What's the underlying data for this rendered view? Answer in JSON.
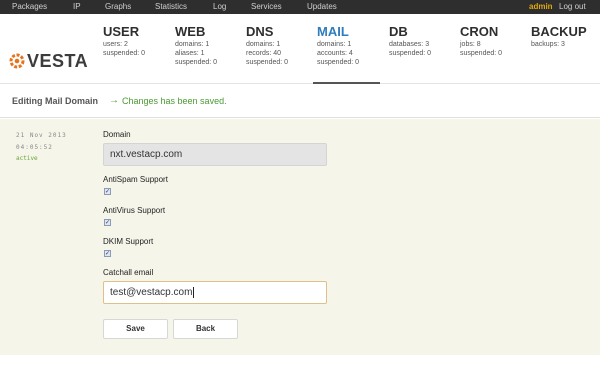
{
  "topnav": {
    "packages": "Packages",
    "ip": "IP",
    "graphs": "Graphs",
    "statistics": "Statistics",
    "log": "Log",
    "services": "Services",
    "updates": "Updates",
    "user": "admin",
    "logout": "Log out"
  },
  "logo": {
    "text": "VESTA",
    "icon": "vesta-gear-logo-icon"
  },
  "sections": {
    "user": {
      "title": "USER",
      "stats": [
        "users: 2",
        "suspended: 0"
      ]
    },
    "web": {
      "title": "WEB",
      "stats": [
        "domains: 1",
        "aliases: 1",
        "suspended: 0"
      ]
    },
    "dns": {
      "title": "DNS",
      "stats": [
        "domains: 1",
        "records: 40",
        "suspended: 0"
      ]
    },
    "mail": {
      "title": "MAIL",
      "stats": [
        "domains: 1",
        "accounts: 4",
        "suspended: 0"
      ]
    },
    "db": {
      "title": "DB",
      "stats": [
        "databases: 3",
        "suspended: 0"
      ]
    },
    "cron": {
      "title": "CRON",
      "stats": [
        "jobs: 8",
        "suspended: 0"
      ]
    },
    "backup": {
      "title": "BACKUP",
      "stats": [
        "backups: 3"
      ]
    }
  },
  "subheader": {
    "title": "Editing Mail Domain",
    "arrow": "→",
    "message": "Changes has been saved."
  },
  "meta": {
    "date": "21 Nov 2013",
    "time": "04:05:52",
    "status": "active"
  },
  "form": {
    "domain_label": "Domain",
    "domain_value": "nxt.vestacp.com",
    "antispam_label": "AntiSpam Support",
    "antispam_checked": true,
    "antivirus_label": "AntiVirus Support",
    "antivirus_checked": true,
    "dkim_label": "DKIM Support",
    "dkim_checked": true,
    "catchall_label": "Catchall email",
    "catchall_value": "test@vestacp.com",
    "check_glyph": "✓"
  },
  "buttons": {
    "save": "Save",
    "back": "Back"
  },
  "colors": {
    "topbar": "#2e2e2e",
    "accent_active": "#2f7dbd",
    "admin": "#e0a80d",
    "success": "#4a9a33",
    "logo_orange": "#e8731b",
    "form_bg": "#f5f5ea"
  }
}
